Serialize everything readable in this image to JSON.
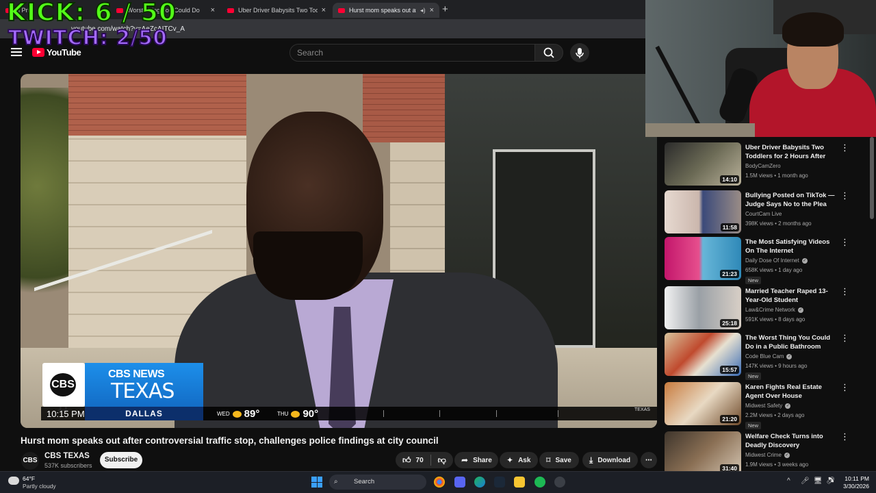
{
  "overlay": {
    "kick": "KICK: 6 / 50",
    "twitch": "TWITCH: 2/50"
  },
  "browser": {
    "tabs": [
      {
        "title": "n Pris"
      },
      {
        "title": "Worst Thing You Could Do"
      },
      {
        "title": "Uber Driver Babysits Two Toddl"
      },
      {
        "title": "Hurst mom speaks out afte"
      }
    ],
    "url": "youtube.com/watch?v=AeZcAITCv_A"
  },
  "youtube": {
    "logo_text": "YouTube",
    "search_placeholder": "Search"
  },
  "video": {
    "chyron": {
      "brand_logo": "CBS 11",
      "network": "CBS NEWS",
      "region": "TEXAS",
      "time": "10:15 PM",
      "city": "DALLAS",
      "weather": [
        {
          "day": "WED",
          "temp": "89°"
        },
        {
          "day": "THU",
          "temp": "90°"
        }
      ],
      "bug": "TEXAS"
    },
    "title": "Hurst mom speaks out after controversial traffic stop, challenges police findings at city council",
    "channel": {
      "avatar": "CBS 11",
      "name": "CBS TEXAS",
      "subscribers": "537K subscribers"
    },
    "subscribe_label": "Subscribe",
    "actions": {
      "likes": "70",
      "share": "Share",
      "ask": "Ask",
      "save": "Save",
      "download": "Download"
    }
  },
  "recommendations": [
    {
      "title": "Uber Driver Babysits Two Toddlers for 2 Hours After Mo...",
      "channel": "BodyCamZero",
      "meta": "1.5M views • 1 month ago",
      "duration": "14:10",
      "verified": false,
      "badge": ""
    },
    {
      "title": "Bullying Posted on TikTok — Judge Says No to the Plea",
      "channel": "CourtCam Live",
      "meta": "398K views • 2 months ago",
      "duration": "11:58",
      "verified": false,
      "badge": ""
    },
    {
      "title": "The Most Satisfying Videos On The Internet",
      "channel": "Daily Dose Of Internet",
      "meta": "658K views • 1 day ago",
      "duration": "21:23",
      "verified": true,
      "badge": "New"
    },
    {
      "title": "Married Teacher Raped 13-Year-Old Student",
      "channel": "Law&Crime Network",
      "meta": "591K views • 8 days ago",
      "duration": "25:18",
      "verified": true,
      "badge": ""
    },
    {
      "title": "The Worst Thing You Could Do in a Public Bathroom",
      "channel": "Code Blue Cam",
      "meta": "147K views • 9 hours ago",
      "duration": "15:57",
      "verified": true,
      "badge": "New"
    },
    {
      "title": "Karen Fights Real Estate Agent Over House",
      "channel": "Midwest Safety",
      "meta": "2.2M views • 2 days ago",
      "duration": "21:20",
      "verified": true,
      "badge": "New"
    },
    {
      "title": "Welfare Check Turns into Deadly Discovery",
      "channel": "Midwest Crime",
      "meta": "1.9M views • 3 weeks ago",
      "duration": "31:40",
      "verified": true,
      "badge": ""
    }
  ],
  "taskbar": {
    "weather_temp": "64°F",
    "weather_cond": "Partly cloudy",
    "search": "Search",
    "time": "10:11 PM",
    "date": "3/30/2026"
  }
}
